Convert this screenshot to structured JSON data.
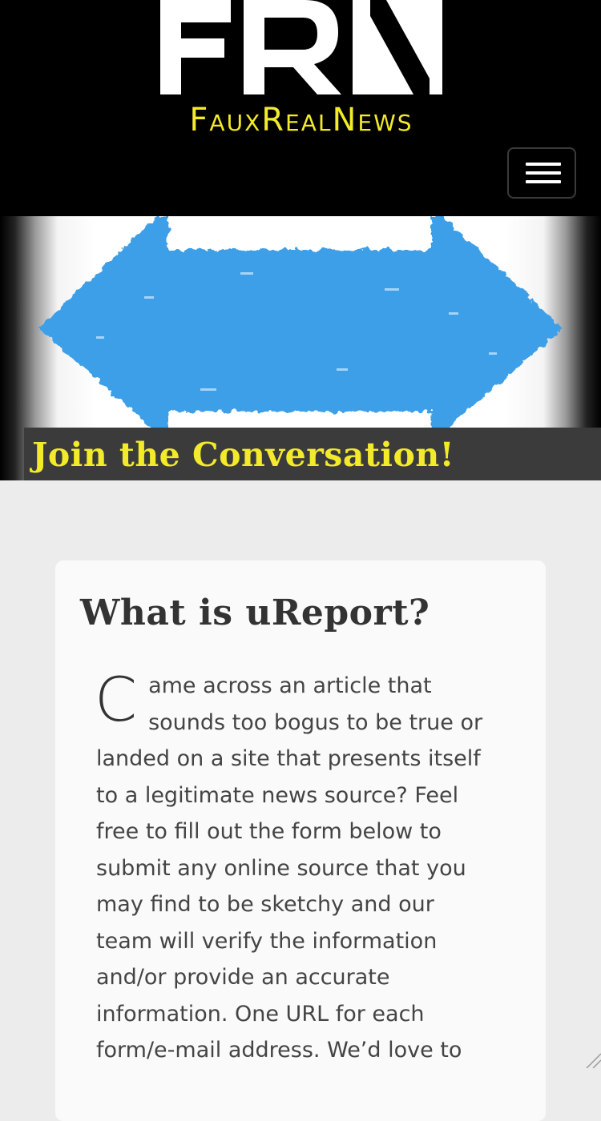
{
  "header": {
    "logo_mark_text": "FRN",
    "logo_wordmark": "FauxRealNews",
    "menu_icon": "hamburger-menu-icon",
    "background_color": "#000000",
    "accent_color": "#f2ea2a"
  },
  "hero": {
    "graphic": "double-headed-arrow",
    "arrow_color": "#3d9fe8",
    "caption": "Join the Conversation!"
  },
  "card": {
    "title": "What is uReport?",
    "dropcap": "C",
    "body_lines": [
      "ame across an article that",
      "sounds too bogus to be true or",
      "landed on a site that presents itself",
      "to a legitimate news source? Feel",
      "free to fill out the form below to",
      "submit any online source that you",
      "may find to be sketchy and our",
      "team will verify the information",
      "and/or provide an accurate",
      "information. One URL for each",
      "form/e-mail address. We’d love to"
    ]
  }
}
